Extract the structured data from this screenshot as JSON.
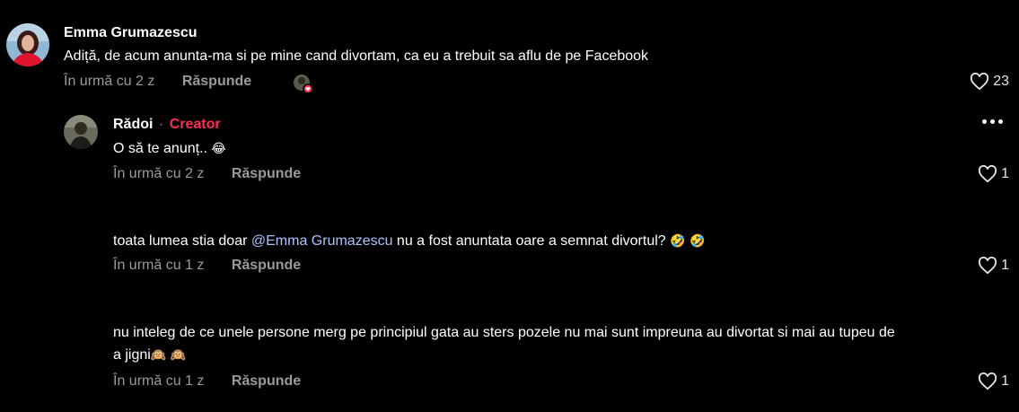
{
  "comments": [
    {
      "author": "Emma Grumazescu",
      "text": "Adiță, de acum anunta-ma si pe mine cand divortam, ca eu a trebuit sa aflu de pe Facebook",
      "time": "În urmă cu 2 z",
      "reply": "Răspunde",
      "likes": "23"
    },
    {
      "author": "Rădoi",
      "separator": "·",
      "badge": "Creator",
      "text": "O să te anunț..",
      "emoji": "😂",
      "time": "În urmă cu 2 z",
      "reply": "Răspunde",
      "likes": "1"
    },
    {
      "text_before": "toata lumea stia doar ",
      "mention": "@Emma Grumazescu",
      "text_after": " nu a fost anuntata oare a semnat divortul?",
      "emoji": "🤣 🤣",
      "time": "În urmă cu 1 z",
      "reply": "Răspunde",
      "likes": "1"
    },
    {
      "text_line1": "nu inteleg de ce unele persone merg pe principiul gata au sters pozele nu mai sunt impreuna au divortat si mai au tupeu de",
      "text_line2": "a jigni",
      "emoji": "🙉 🙉",
      "time": "În urmă cu 1 z",
      "reply": "Răspunde",
      "likes": "1"
    }
  ],
  "icons": {
    "like": "heart-outline-icon",
    "more": "more-horizontal-icon"
  },
  "colors": {
    "creator": "#fe2c55",
    "mention": "#a9c3ff",
    "meta": "#9a9a9a"
  }
}
